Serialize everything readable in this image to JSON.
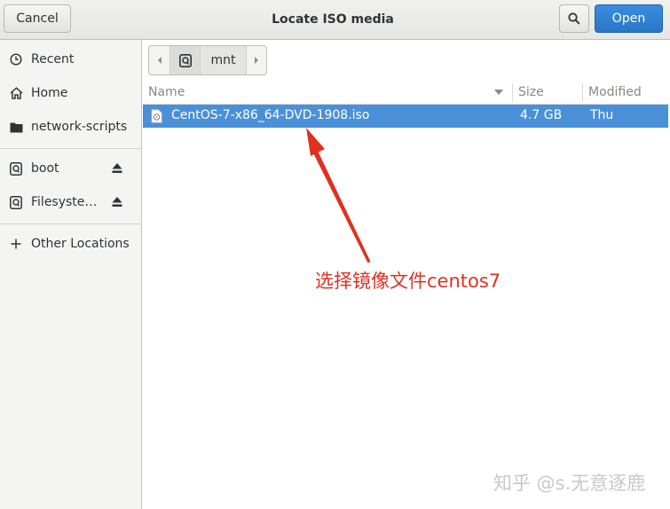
{
  "header": {
    "title": "Locate ISO media",
    "cancel_label": "Cancel",
    "open_label": "Open",
    "search_icon": "search-icon",
    "accent_color": "#2a76c6"
  },
  "sidebar": {
    "items": [
      {
        "label": "Recent",
        "icon": "clock-icon"
      },
      {
        "label": "Home",
        "icon": "home-icon"
      },
      {
        "label": "network-scripts",
        "icon": "folder-icon"
      },
      {
        "label": "boot",
        "icon": "drive-icon",
        "eject": true
      },
      {
        "label": "Filesyste…",
        "icon": "drive-icon",
        "eject": true
      },
      {
        "label": "Other Locations",
        "icon": "plus-icon"
      }
    ]
  },
  "pathbar": {
    "current": "mnt"
  },
  "filelist": {
    "columns": {
      "name": "Name",
      "size": "Size",
      "modified": "Modified"
    },
    "rows": [
      {
        "name": "CentOS-7-x86_64-DVD-1908.iso",
        "size": "4.7 GB",
        "modified": "Thu",
        "selected": true
      }
    ],
    "selection_color": "#4a90d9"
  },
  "annotation": {
    "text": "选择镜像文件centos7",
    "color": "#e03020"
  },
  "watermark": {
    "text": "知乎 @s.无意逐鹿"
  }
}
